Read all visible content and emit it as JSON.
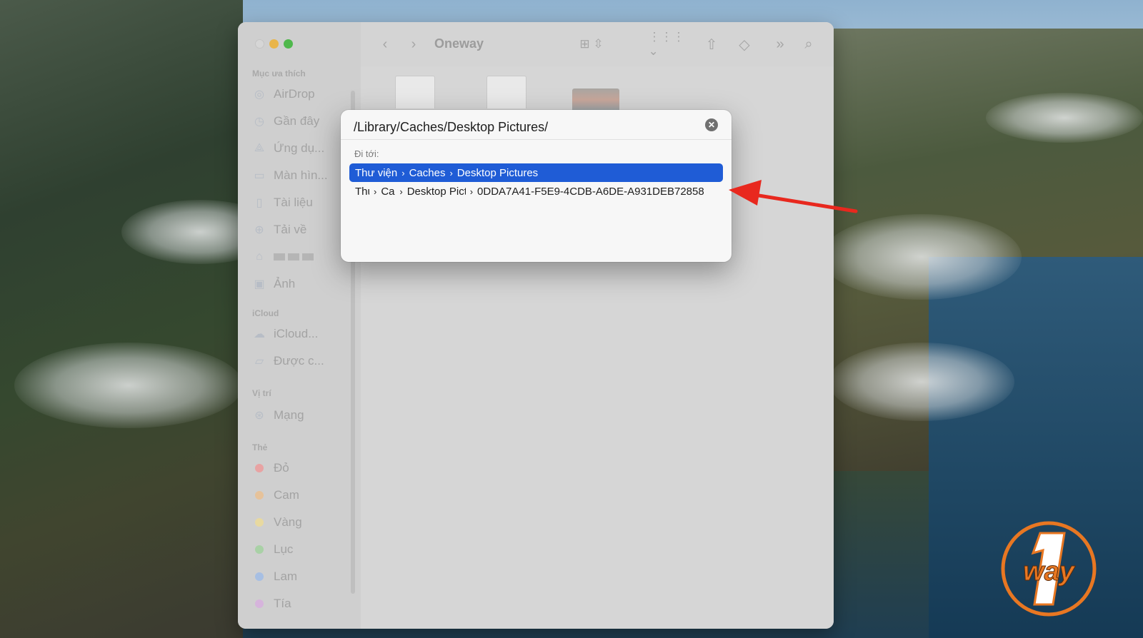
{
  "finder": {
    "title": "Oneway",
    "sidebar": {
      "sections": {
        "favorites": "Mục ưa thích",
        "icloud": "iCloud",
        "locations": "Vị trí",
        "tags": "Thẻ"
      },
      "favorites": [
        {
          "label": "AirDrop",
          "icon": "airdrop-icon"
        },
        {
          "label": "Gần đây",
          "icon": "clock-icon"
        },
        {
          "label": "Ứng dụ...",
          "icon": "applications-icon"
        },
        {
          "label": "Màn hìn...",
          "icon": "desktop-icon"
        },
        {
          "label": "Tài liệu",
          "icon": "document-icon"
        },
        {
          "label": "Tải về",
          "icon": "download-icon"
        },
        {
          "label": "",
          "icon": "home-icon"
        },
        {
          "label": "Ảnh",
          "icon": "photos-icon"
        }
      ],
      "icloud": [
        {
          "label": "iCloud...",
          "icon": "cloud-icon"
        },
        {
          "label": "Được c...",
          "icon": "shared-folder-icon"
        }
      ],
      "locations": [
        {
          "label": "Mạng",
          "icon": "network-icon"
        }
      ],
      "tags": [
        {
          "label": "Đỏ",
          "color": "#e8a3a3"
        },
        {
          "label": "Cam",
          "color": "#e6c29a"
        },
        {
          "label": "Vàng",
          "color": "#e8d9a0"
        },
        {
          "label": "Lục",
          "color": "#a9d1a6"
        },
        {
          "label": "Lam",
          "color": "#a7bfe3"
        },
        {
          "label": "Tía",
          "color": "#d6b4dc"
        }
      ]
    },
    "toolbar_icons": [
      "back-icon",
      "forward-icon",
      "icon-view-icon",
      "group-icon",
      "share-icon",
      "tag-icon",
      "more-icon",
      "search-icon"
    ]
  },
  "goto": {
    "path": "/Library/Caches/Desktop Pictures/",
    "heading": "Đi tới:",
    "results": [
      {
        "parts": [
          "Thư viện",
          "Caches",
          "Desktop Pictures"
        ]
      },
      {
        "parts": [
          "Thư viện",
          "Caches",
          "Desktop Pictures",
          "0DDA7A41-F5E9-4CDB-A6DE-A931DEB72858"
        ]
      }
    ],
    "accent": "#1f5cd6"
  },
  "annotation": {
    "arrow_color": "#e8281e"
  },
  "brand": {
    "text": "way",
    "digit": "1",
    "color": "#e87722"
  }
}
